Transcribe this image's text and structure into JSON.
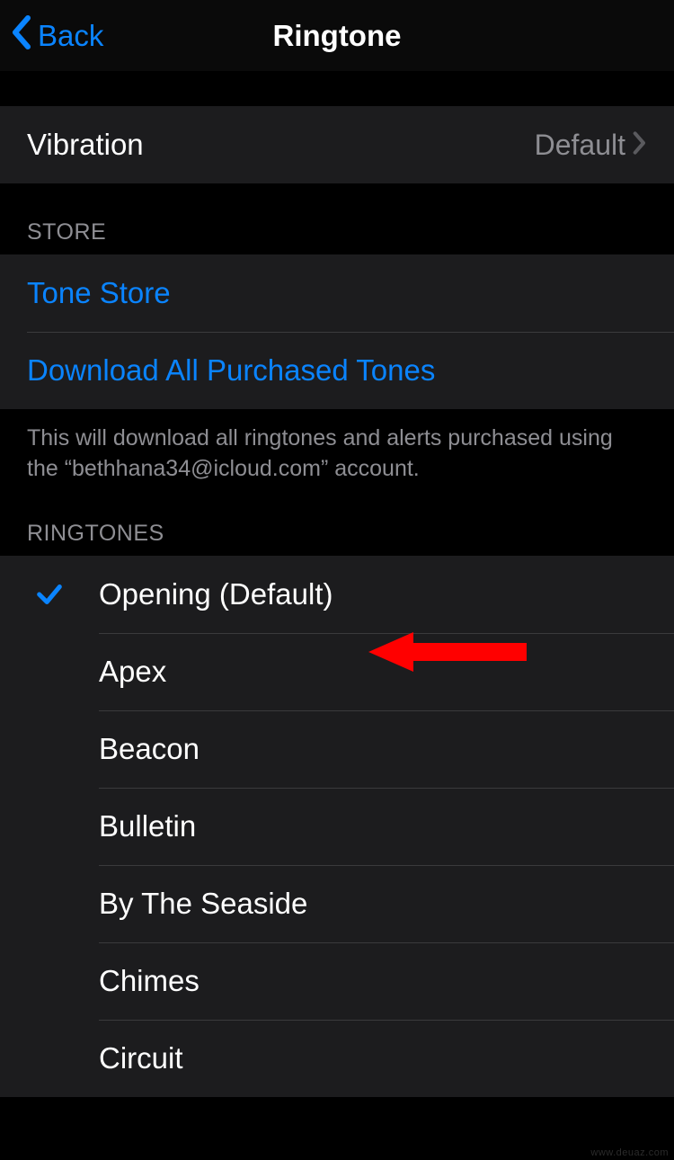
{
  "nav": {
    "back_label": "Back",
    "title": "Ringtone"
  },
  "vibration": {
    "label": "Vibration",
    "value": "Default"
  },
  "store": {
    "header": "STORE",
    "tone_store": "Tone Store",
    "download_all": "Download All Purchased Tones",
    "footer": "This will download all ringtones and alerts purchased using the “bethhana34@icloud.com” account."
  },
  "ringtones": {
    "header": "RINGTONES",
    "items": [
      {
        "label": "Opening (Default)",
        "selected": true
      },
      {
        "label": "Apex",
        "selected": false
      },
      {
        "label": "Beacon",
        "selected": false
      },
      {
        "label": "Bulletin",
        "selected": false
      },
      {
        "label": "By The Seaside",
        "selected": false
      },
      {
        "label": "Chimes",
        "selected": false
      },
      {
        "label": "Circuit",
        "selected": false
      }
    ]
  },
  "colors": {
    "accent": "#0a84ff",
    "annotation": "#ff0000"
  },
  "watermark": "www.deuaz.com"
}
